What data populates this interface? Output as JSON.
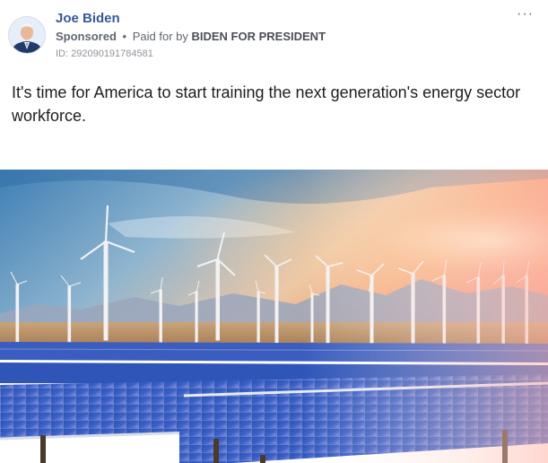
{
  "post": {
    "author": "Joe Biden",
    "sponsored_label": "Sponsored",
    "separator": "•",
    "paid_for_label": "Paid for by",
    "payer": "BIDEN FOR PRESIDENT",
    "ad_id": "ID: 292090191784581",
    "more_icon": "more-horizontal-icon",
    "more_glyph": "···",
    "text": "It's time for America to start training the next generation's energy sector workforce.",
    "image": {
      "subject": "solar panels and wind turbines in desert at sunset"
    }
  }
}
